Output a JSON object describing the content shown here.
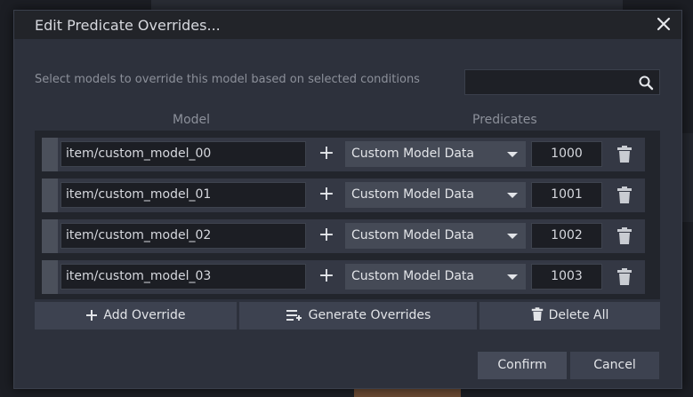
{
  "dialog": {
    "title": "Edit Predicate Overrides...",
    "description": "Select models to override this model based on selected conditions",
    "search": {
      "value": "",
      "placeholder": ""
    },
    "columns": {
      "model": "Model",
      "predicates": "Predicates"
    },
    "overrides": [
      {
        "model": "item/custom_model_00",
        "predicate": "Custom Model Data",
        "value": "1000"
      },
      {
        "model": "item/custom_model_01",
        "predicate": "Custom Model Data",
        "value": "1001"
      },
      {
        "model": "item/custom_model_02",
        "predicate": "Custom Model Data",
        "value": "1002"
      },
      {
        "model": "item/custom_model_03",
        "predicate": "Custom Model Data",
        "value": "1003"
      }
    ],
    "actions": {
      "add_override": "Add Override",
      "generate_overrides": "Generate Overrides",
      "delete_all": "Delete All"
    },
    "footer": {
      "confirm": "Confirm",
      "cancel": "Cancel"
    },
    "icons": {
      "close": "close-icon",
      "search": "search-icon",
      "add_predicate": "plus-icon",
      "dropdown": "caret-down-icon",
      "delete": "trash-icon",
      "drag": "drag-handle",
      "generate": "list-add-icon"
    },
    "colors": {
      "titlebar": "#222429",
      "body": "#2d313c",
      "button": "#3d4250",
      "accent_text": "#e2e4e8"
    }
  }
}
